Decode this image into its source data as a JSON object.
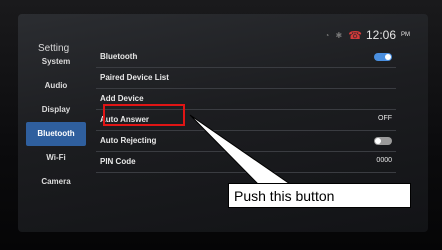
{
  "screen": {
    "title": "Setting",
    "clock": "12:06",
    "ampm": "PM",
    "status_icons": "wifi-icon bluetooth-icon",
    "phone_icon": "phone-icon"
  },
  "sidebar": {
    "items": [
      {
        "label": "System"
      },
      {
        "label": "Audio"
      },
      {
        "label": "Display"
      },
      {
        "label": "Bluetooth",
        "active": true
      },
      {
        "label": "Wi-Fi"
      },
      {
        "label": "Camera"
      }
    ]
  },
  "settings": {
    "rows": [
      {
        "label": "Bluetooth",
        "control": "toggle-on"
      },
      {
        "label": "Paired Device List"
      },
      {
        "label": "Add Device"
      },
      {
        "label": "Auto Answer",
        "value": "OFF"
      },
      {
        "label": "Auto Rejecting",
        "control": "toggle-off"
      },
      {
        "label": "PIN Code",
        "value": "0000"
      }
    ]
  },
  "annotation": {
    "text": "Push this button",
    "highlight_color": "#e01515"
  },
  "colors": {
    "accent": "#2f5f9e",
    "toggle_on": "#4a8fe0"
  }
}
